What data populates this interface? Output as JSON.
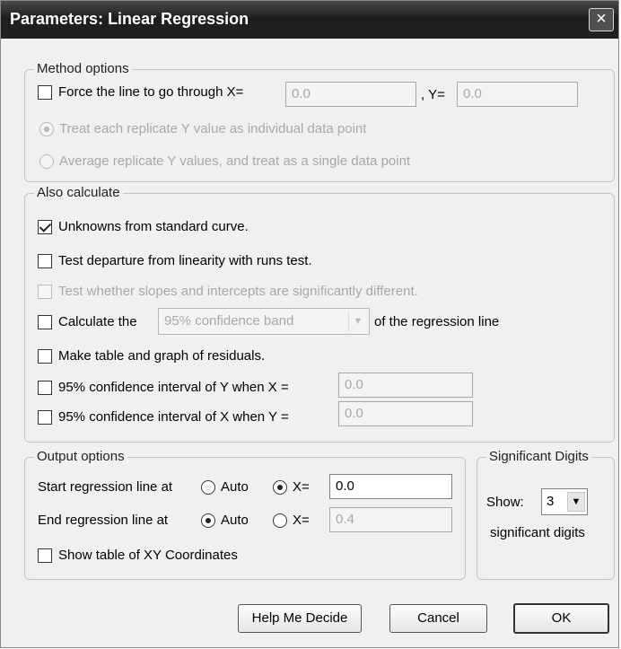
{
  "window": {
    "title": "Parameters: Linear Regression",
    "close_icon": "×"
  },
  "method_options": {
    "legend": "Method options",
    "force_line_label": "Force the line to go through X=",
    "force_x_value": "0.0",
    "y_label": ", Y=",
    "force_y_value": "0.0",
    "radio_individual": "Treat each replicate Y value as individual data point",
    "radio_average": "Average replicate Y values, and treat as a single data point"
  },
  "also_calculate": {
    "legend": "Also calculate",
    "unknowns": "Unknowns from standard curve.",
    "runs_test": "Test departure from linearity with runs test.",
    "slopes_test": "Test whether slopes and intercepts are significantly different.",
    "calc_prefix": "Calculate the",
    "confidence_band_selected": "95% confidence band",
    "calc_suffix": "of the regression line",
    "residuals": "Make table and graph of residuals.",
    "ci_y_label": "95% confidence interval of Y when X =",
    "ci_y_value": "0.0",
    "ci_x_label": "95% confidence interval of X when Y =",
    "ci_x_value": "0.0"
  },
  "output_options": {
    "legend": "Output options",
    "start_label": "Start regression line at",
    "end_label": "End regression line at",
    "auto_label": "Auto",
    "x_label": "X=",
    "start_value": "0.0",
    "end_value": "0.4",
    "show_table": "Show table of XY Coordinates"
  },
  "significant_digits": {
    "legend": "Significant Digits",
    "show_label": "Show:",
    "value": "3",
    "suffix": "significant digits"
  },
  "buttons": {
    "help": "Help Me Decide",
    "cancel": "Cancel",
    "ok": "OK"
  },
  "colors": {
    "titlebar": "#2b2b2b",
    "dialog_bg": "#f0f0f0",
    "disabled_text": "#a8a8a8"
  }
}
